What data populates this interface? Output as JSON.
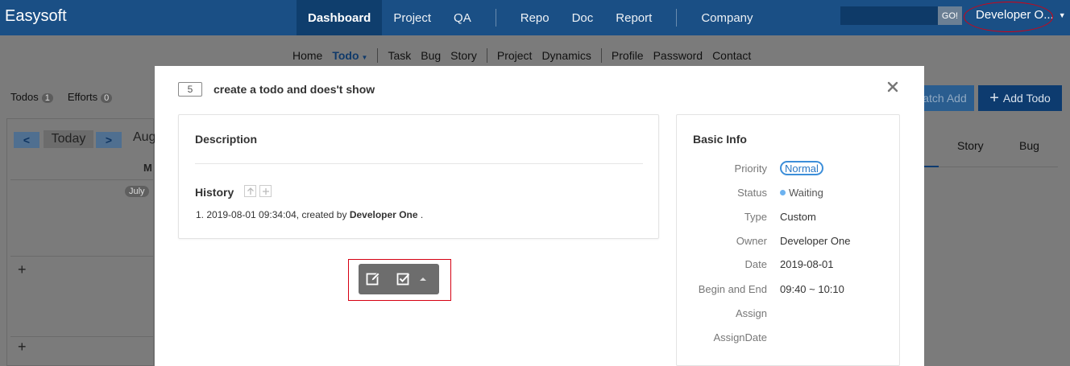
{
  "header": {
    "brand": "Easysoft",
    "nav": [
      "Dashboard",
      "Project",
      "QA",
      "Repo",
      "Doc",
      "Report",
      "Company"
    ],
    "search_button": "GO!",
    "user_name": "Developer O..."
  },
  "subnav": {
    "items": [
      "Home",
      "Todo",
      "Task",
      "Bug",
      "Story",
      "Project",
      "Dynamics",
      "Profile",
      "Password",
      "Contact"
    ]
  },
  "page": {
    "todos_label": "Todos",
    "todos_count": "1",
    "efforts_label": "Efforts",
    "efforts_count": "0",
    "calendar": {
      "today": "Today",
      "month": "Aug",
      "weekday": "M",
      "month_badge": "July",
      "plus": "+"
    },
    "batch_add": "atch Add",
    "add_todo": "Add Todo",
    "tabs": [
      "Story",
      "Bug"
    ]
  },
  "modal": {
    "id": "5",
    "title": "create a todo and does't show",
    "description_label": "Description",
    "history_label": "History",
    "history": [
      {
        "prefix": "1. 2019-08-01 09:34:04, created by",
        "actor": "Developer One",
        "suffix": "."
      }
    ],
    "basic_info_title": "Basic Info",
    "info": {
      "priority_label": "Priority",
      "priority": "Normal",
      "status_label": "Status",
      "status": "Waiting",
      "type_label": "Type",
      "type": "Custom",
      "owner_label": "Owner",
      "owner": "Developer One",
      "date_label": "Date",
      "date": "2019-08-01",
      "begin_end_label": "Begin and End",
      "begin_end": "09:40 ~ 10:10",
      "assign_label": "Assign",
      "assign": "",
      "assign_date_label": "AssignDate",
      "assign_date": ""
    }
  },
  "colors": {
    "header": "#1a4f85",
    "accent": "#3c8ed9",
    "highlight": "#d60012"
  }
}
